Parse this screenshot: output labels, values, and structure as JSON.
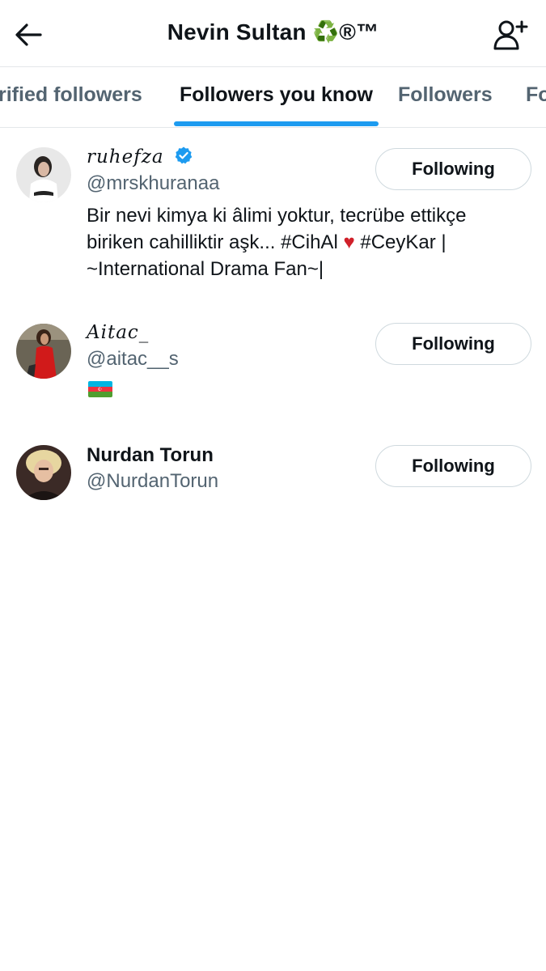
{
  "header": {
    "title": "Nevin Sultan",
    "title_emoji": "♻️",
    "title_suffix": "®™",
    "back_icon": "arrow-left-icon",
    "add_user_icon": "add-user-icon"
  },
  "tabs": [
    {
      "label": "Verified followers",
      "visible_text": "rified followers",
      "active": false
    },
    {
      "label": "Followers you know",
      "visible_text": "Followers you know",
      "active": true
    },
    {
      "label": "Followers",
      "visible_text": "Followers",
      "active": false
    },
    {
      "label": "Following",
      "visible_text": "Fo",
      "active": false
    }
  ],
  "users": [
    {
      "name": "𝑟𝑢ℎ𝑒𝑓𝑧𝑎",
      "verified": true,
      "handle": "@mrskhuranaa",
      "bio_line1": "Bir nevi kimya ki âlimi yoktur, tecrübe ettikçe",
      "bio_line2_a": "biriken cahilliktir aşk... #CihAl ",
      "bio_heart": "♥",
      "bio_line2_b": " #CeyKar |",
      "bio_line3": "~International Drama Fan~|",
      "button": "Following"
    },
    {
      "name": "𝐴𝑖𝑡𝑎𝑐_",
      "verified": false,
      "handle": "@aitac__s",
      "bio_flag": "azerbaijan-flag",
      "button": "Following"
    },
    {
      "name": "Nurdan Torun",
      "verified": false,
      "handle": "@NurdanTorun",
      "button": "Following"
    }
  ],
  "colors": {
    "accent": "#1d9bf0",
    "text_primary": "#0f1419",
    "text_secondary": "#536471",
    "border": "#cfd9de"
  }
}
